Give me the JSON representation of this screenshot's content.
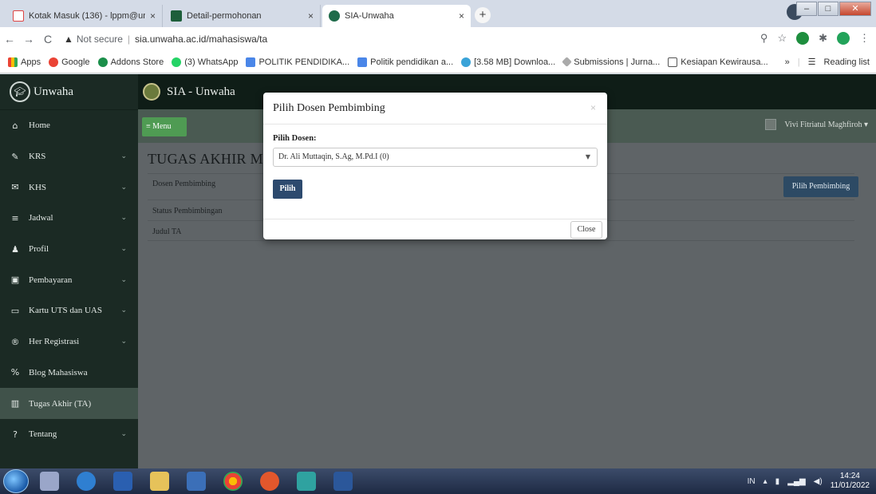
{
  "browser": {
    "tabs": [
      {
        "title": "Kotak Masuk (136) - lppm@unw",
        "close": "×"
      },
      {
        "title": "Detail-permohonan",
        "close": "×"
      },
      {
        "title": "SIA-Unwaha",
        "close": "×"
      }
    ],
    "new_tab": "+",
    "back": "←",
    "forward": "→",
    "reload": "C",
    "security_icon": "▲",
    "security_label": "Not secure",
    "url": "sia.unwaha.ac.id/mahasiswa/ta",
    "bookmarks": [
      {
        "label": "Apps",
        "icon_color": "#4285f4"
      },
      {
        "label": "Google",
        "icon_color": "#ea4335"
      },
      {
        "label": "Addons Store",
        "icon_color": "#1b8f4a"
      },
      {
        "label": "(3) WhatsApp",
        "icon_color": "#25d366"
      },
      {
        "label": "POLITIK PENDIDIKA...",
        "icon_color": "#4a86e8"
      },
      {
        "label": "Politik pendidikan a...",
        "icon_color": "#4a86e8"
      },
      {
        "label": "[3.58 MB] Downloa...",
        "icon_color": "#3aa3d8"
      },
      {
        "label": "Submissions | Jurna...",
        "icon_color": "#888888"
      },
      {
        "label": "Kesiapan Kewirausa...",
        "icon_color": "#555555"
      }
    ],
    "more": "»",
    "reading_list": "Reading list"
  },
  "sidebar": {
    "brand": "Unwaha",
    "items": [
      {
        "label": "Home",
        "icon": "home-icon",
        "glyph": "⌂",
        "chevron": false
      },
      {
        "label": "KRS",
        "icon": "edit-icon",
        "glyph": "✎",
        "chevron": true
      },
      {
        "label": "KHS",
        "icon": "envelope-icon",
        "glyph": "✉",
        "chevron": true
      },
      {
        "label": "Jadwal",
        "icon": "list-icon",
        "glyph": "≡",
        "chevron": true
      },
      {
        "label": "Profil",
        "icon": "user-icon",
        "glyph": "♟",
        "chevron": true
      },
      {
        "label": "Pembayaran",
        "icon": "money-icon",
        "glyph": "▣",
        "chevron": true
      },
      {
        "label": "Kartu UTS dan UAS",
        "icon": "card-icon",
        "glyph": "▭",
        "chevron": true
      },
      {
        "label": "Her Registrasi",
        "icon": "registered-icon",
        "glyph": "®",
        "chevron": true
      },
      {
        "label": "Blog Mahasiswa",
        "icon": "link-icon",
        "glyph": "%",
        "chevron": false
      },
      {
        "label": "Tugas Akhir (TA)",
        "icon": "book-icon",
        "glyph": "▥",
        "chevron": false,
        "active": true
      },
      {
        "label": "Tentang",
        "icon": "question-icon",
        "glyph": "?",
        "chevron": true
      }
    ]
  },
  "header": {
    "site_title": "SIA - Unwaha",
    "menu_button": "≡ Menu",
    "user_name": "Vivi Fitriatul Maghfiroh ▾"
  },
  "content": {
    "page_title": "TUGAS AKHIR MA",
    "rows": [
      "Dosen Pembimbing",
      "Status Pembimbingan",
      "Judul TA"
    ],
    "pilih_pembimbing_button": "Pilih Pembimbing"
  },
  "modal": {
    "title": "Pilih Dosen Pembimbing",
    "close_x": "×",
    "field_label": "Pilih Dosen:",
    "selected_dosen": "Dr. Ali Muttaqin, S.Ag, M.Pd.I (0)",
    "submit_button": "Pilih",
    "close_button": "Close"
  },
  "taskbar": {
    "lang": "IN",
    "time": "14:24",
    "date": "11/01/2022"
  }
}
